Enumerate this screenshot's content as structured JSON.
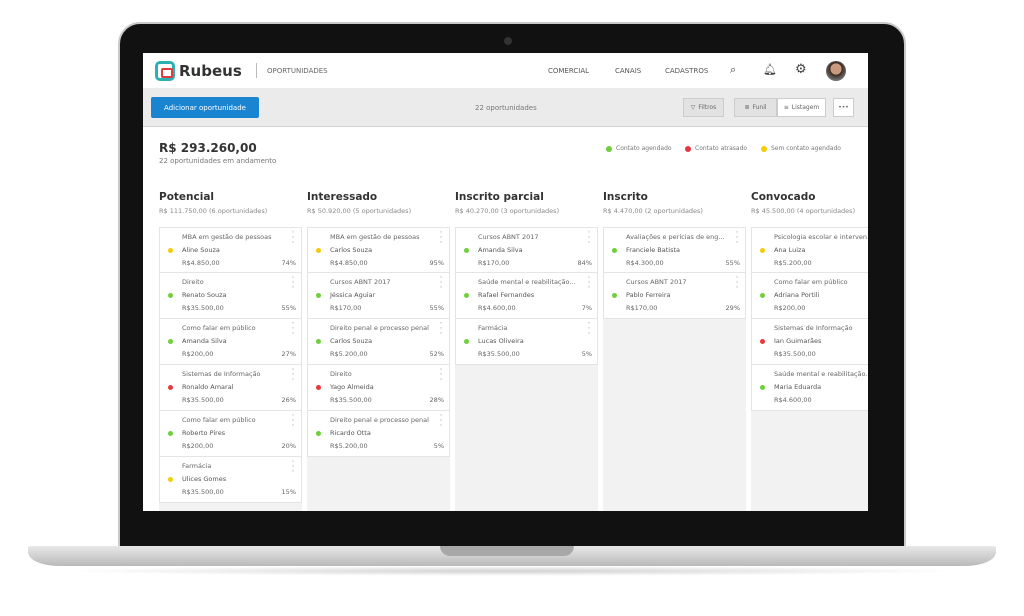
{
  "colors": {
    "accent": "#1b84d1",
    "green": "#6fcf3b",
    "red": "#e8383d",
    "yellow": "#f5cb0a"
  },
  "header": {
    "logo": "Rubeus",
    "section": "OPORTUNIDADES",
    "nav": [
      "COMERCIAL",
      "CANAIS",
      "CADASTROS"
    ],
    "icons": [
      "search-icon",
      "bell-icon",
      "gear-icon",
      "avatar"
    ]
  },
  "toolbar": {
    "add_label": "Adicionar oportunidade",
    "count": "22 oportunidades",
    "filters": "Filtros",
    "funnel": "Funil",
    "list": "Listagem",
    "more": "•••"
  },
  "summary": {
    "total": "R$ 293.260,00",
    "subtitle": "22 oportunidades em andamento"
  },
  "legend": [
    {
      "label": "Contato agendado",
      "color": "#6fcf3b"
    },
    {
      "label": "Contato atrasado",
      "color": "#e8383d"
    },
    {
      "label": "Sem contato agendado",
      "color": "#f5cb0a"
    }
  ],
  "columns": [
    {
      "title": "Potencial",
      "subtitle": "R$ 111.750,00 (6 oportunidades)",
      "cards": [
        {
          "course": "MBA em gestão de pessoas",
          "name": "Aline Souza",
          "value": "R$4.850,00",
          "pct": "74%",
          "status": "yellow"
        },
        {
          "course": "Direito",
          "name": "Renato Souza",
          "value": "R$35.500,00",
          "pct": "55%",
          "status": "green"
        },
        {
          "course": "Como falar em público",
          "name": "Amanda Silva",
          "value": "R$200,00",
          "pct": "27%",
          "status": "green"
        },
        {
          "course": "Sistemas de Informação",
          "name": "Ronaldo Amaral",
          "value": "R$35.500,00",
          "pct": "26%",
          "status": "red"
        },
        {
          "course": "Como falar em público",
          "name": "Roberto Pires",
          "value": "R$200,00",
          "pct": "20%",
          "status": "green"
        },
        {
          "course": "Farmácia",
          "name": "Ulices Gomes",
          "value": "R$35.500,00",
          "pct": "15%",
          "status": "yellow"
        }
      ]
    },
    {
      "title": "Interessado",
      "subtitle": "R$ 50.920,00 (5 oportunidades)",
      "cards": [
        {
          "course": "MBA em gestão de pessoas",
          "name": "Carlos Souza",
          "value": "R$4.850,00",
          "pct": "95%",
          "status": "yellow"
        },
        {
          "course": "Cursos ABNT 2017",
          "name": "Jéssica Aguiar",
          "value": "R$170,00",
          "pct": "55%",
          "status": "green"
        },
        {
          "course": "Direito penal e processo penal",
          "name": "Carlos Souza",
          "value": "R$5.200,00",
          "pct": "52%",
          "status": "green"
        },
        {
          "course": "Direito",
          "name": "Yago Almeida",
          "value": "R$35.500,00",
          "pct": "28%",
          "status": "red"
        },
        {
          "course": "Direito penal e processo penal",
          "name": "Ricardo Otta",
          "value": "R$5.200,00",
          "pct": "5%",
          "status": "green"
        }
      ]
    },
    {
      "title": "Inscrito parcial",
      "subtitle": "R$ 40.270,00 (3 oportunidades)",
      "cards": [
        {
          "course": "Cursos ABNT 2017",
          "name": "Amanda Silva",
          "value": "R$170,00",
          "pct": "84%",
          "status": "green"
        },
        {
          "course": "Saúde mental e reabilitação...",
          "name": "Rafael Fernandes",
          "value": "R$4.600,00",
          "pct": "7%",
          "status": "green"
        },
        {
          "course": "Farmácia",
          "name": "Lucas Oliveira",
          "value": "R$35.500,00",
          "pct": "5%",
          "status": "green"
        }
      ]
    },
    {
      "title": "Inscrito",
      "subtitle": "R$ 4.470,00 (2 oportunidades)",
      "cards": [
        {
          "course": "Avaliações e perícias de eng...",
          "name": "Franciele Batista",
          "value": "R$4.300,00",
          "pct": "55%",
          "status": "green"
        },
        {
          "course": "Cursos ABNT 2017",
          "name": "Pablo Ferreira",
          "value": "R$170,00",
          "pct": "29%",
          "status": "green"
        }
      ]
    },
    {
      "title": "Convocado",
      "subtitle": "R$ 45.500,00 (4 oportunidades)",
      "cards": [
        {
          "course": "Psicologia escolar e interven...",
          "name": "Ana Luiza",
          "value": "R$5.200,00",
          "pct": "",
          "status": "yellow"
        },
        {
          "course": "Como falar em público",
          "name": "Adriana Portili",
          "value": "R$200,00",
          "pct": "",
          "status": "green"
        },
        {
          "course": "Sistemas de Informação",
          "name": "Ian Guimarães",
          "value": "R$35.500,00",
          "pct": "",
          "status": "red"
        },
        {
          "course": "Saúde mental e reabilitação...",
          "name": "Maria Eduarda",
          "value": "R$4.600,00",
          "pct": "",
          "status": "green"
        }
      ]
    }
  ]
}
